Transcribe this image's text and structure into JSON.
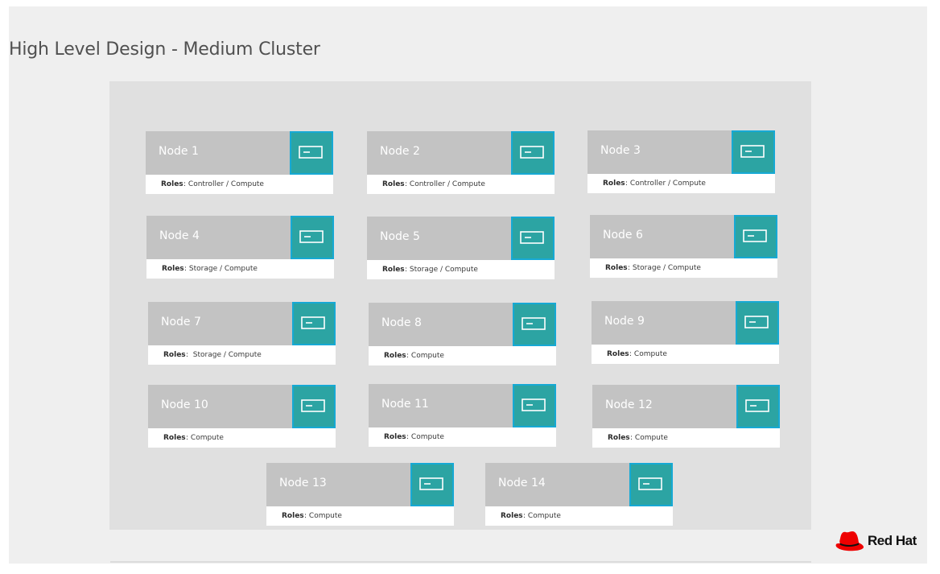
{
  "title": "High Level Design - Medium Cluster",
  "roles_label": "Roles",
  "colors": {
    "slide_background": "#efefef",
    "panel_background": "#e0e0e0",
    "node_header": "#c3c3c3",
    "node_icon_fill": "#2ca4a3",
    "node_icon_border": "#16a9d4",
    "brand_red": "#ee0000"
  },
  "nodes": [
    {
      "name": "Node 1",
      "roles_sep": ": ",
      "roles": "Controller / Compute",
      "icon": "server-icon"
    },
    {
      "name": "Node 2",
      "roles_sep": ": ",
      "roles": "Controller / Compute",
      "icon": "server-icon"
    },
    {
      "name": "Node 3",
      "roles_sep": ": ",
      "roles": "Controller / Compute",
      "icon": "server-icon"
    },
    {
      "name": "Node 4",
      "roles_sep": ": ",
      "roles": "Storage / Compute",
      "icon": "server-icon"
    },
    {
      "name": "Node 5",
      "roles_sep": ": ",
      "roles": "Storage / Compute",
      "icon": "server-icon"
    },
    {
      "name": "Node 6",
      "roles_sep": ": ",
      "roles": "Storage / Compute",
      "icon": "server-icon"
    },
    {
      "name": "Node 7",
      "roles_sep": ":  ",
      "roles": "Storage / Compute",
      "icon": "server-icon"
    },
    {
      "name": "Node 8",
      "roles_sep": ": ",
      "roles": "Compute",
      "icon": "server-icon"
    },
    {
      "name": "Node 9",
      "roles_sep": ": ",
      "roles": "Compute",
      "icon": "server-icon"
    },
    {
      "name": "Node 10",
      "roles_sep": ": ",
      "roles": "Compute",
      "icon": "server-icon"
    },
    {
      "name": "Node 11",
      "roles_sep": ": ",
      "roles": "Compute",
      "icon": "server-icon"
    },
    {
      "name": "Node 12",
      "roles_sep": ": ",
      "roles": "Compute",
      "icon": "server-icon"
    },
    {
      "name": "Node 13",
      "roles_sep": ": ",
      "roles": "Compute",
      "icon": "server-icon"
    },
    {
      "name": "Node 14",
      "roles_sep": ": ",
      "roles": "Compute",
      "icon": "server-icon"
    }
  ],
  "logo": {
    "text": "Red Hat",
    "icon": "red-hat-fedora-icon"
  }
}
